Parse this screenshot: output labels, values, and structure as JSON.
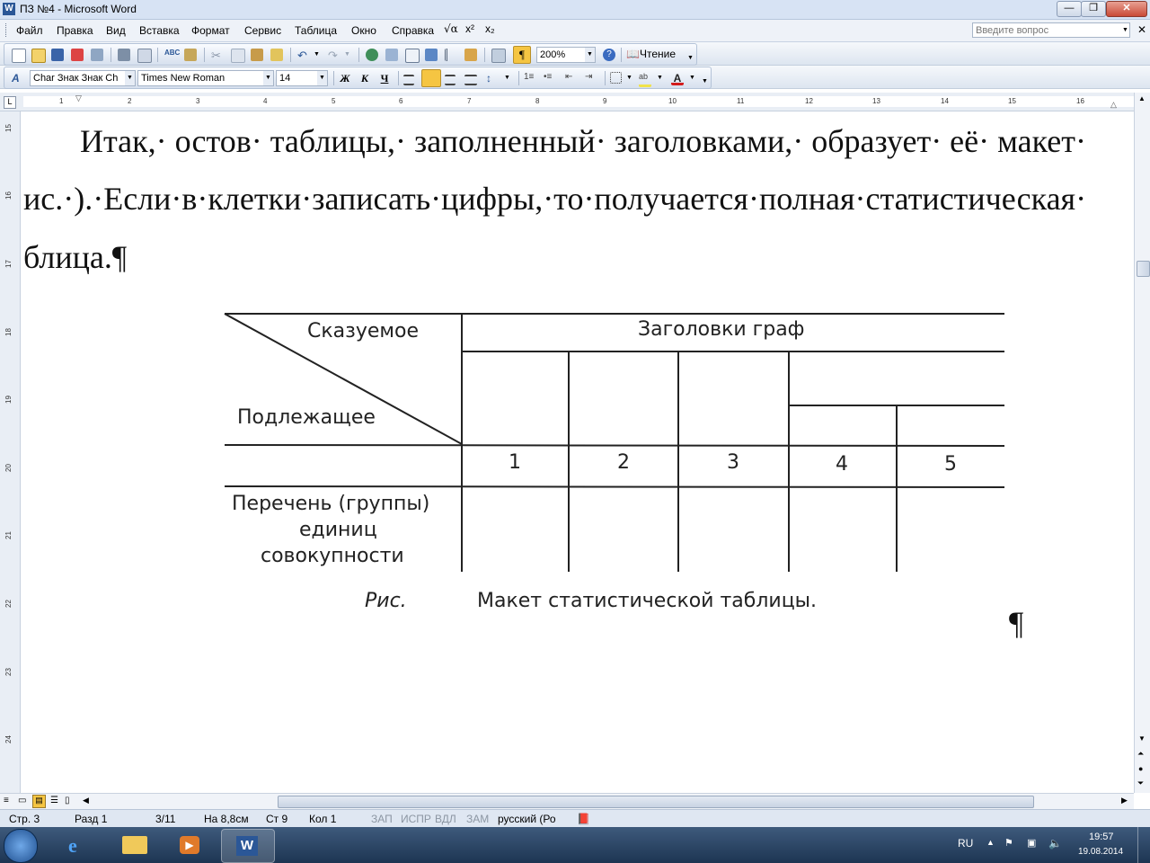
{
  "window": {
    "title": "ПЗ №4 - Microsoft Word"
  },
  "menu": {
    "items": [
      "Файл",
      "Правка",
      "Вид",
      "Вставка",
      "Формат",
      "Сервис",
      "Таблица",
      "Окно",
      "Справка"
    ],
    "search_placeholder": "Введите вопрос"
  },
  "toolbar": {
    "zoom": "200%",
    "reading_label": "Чтение",
    "style": "Char Знак Знак Ch",
    "font": "Times New Roman",
    "size": "14",
    "bold": "Ж",
    "italic": "К",
    "underline": "Ч",
    "pilcrow": "¶"
  },
  "ruler": {
    "h": [
      "1",
      "2",
      "3",
      "4",
      "5",
      "6",
      "7",
      "8",
      "9",
      "10",
      "11",
      "12",
      "13",
      "14",
      "15",
      "16"
    ],
    "v": [
      "15",
      "16",
      "17",
      "18",
      "19",
      "20",
      "21",
      "22",
      "23",
      "24"
    ]
  },
  "document": {
    "lines": [
      "Итак,· остов· таблицы,· заполненный· заголовками,· образует· её· макет·",
      "ис.·).·Если·в·клетки·записать·цифры,·то·получается·полная·статистическая·",
      "блица.¶"
    ],
    "trailing_mark": "¶"
  },
  "figure": {
    "predicate": "Сказуемое",
    "subject": "Подлежащее",
    "column_headers": "Заголовки граф",
    "column_numbers": [
      "1",
      "2",
      "3",
      "4",
      "5"
    ],
    "row_label_lines": [
      "Перечень (группы)",
      "единиц",
      "совокупности"
    ],
    "caption_label": "Рис.",
    "caption_text": "Макет статистической таблицы."
  },
  "status": {
    "page": "Стр. 3",
    "section": "Разд 1",
    "pages": "3/11",
    "at": "На 8,8см",
    "line": "Ст 9",
    "col": "Кол 1",
    "rec": "ЗАП",
    "trk": "ИСПР",
    "ext": "ВДЛ",
    "ovr": "ЗАМ",
    "language": "русский (Ро"
  },
  "taskbar": {
    "lang": "RU",
    "time": "19:57",
    "date": "19.08.2014"
  }
}
